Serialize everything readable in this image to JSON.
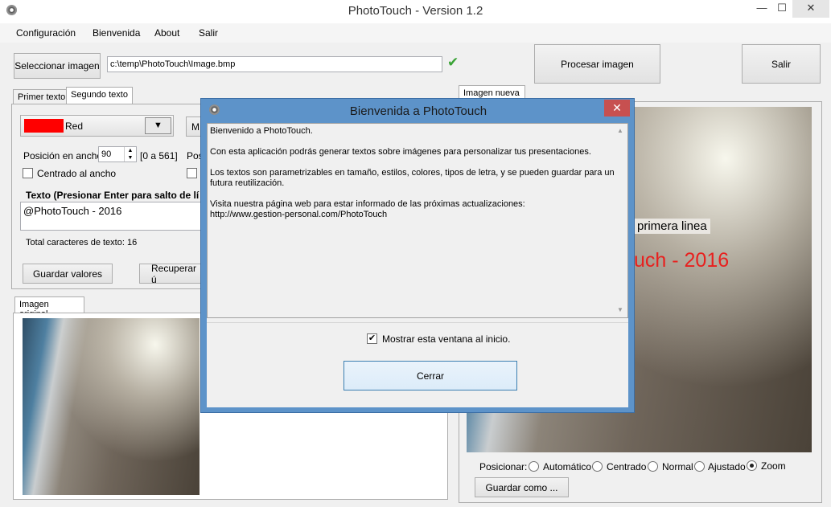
{
  "window": {
    "title": "PhotoTouch - Version 1.2",
    "controls": {
      "minimize": "—",
      "maximize": "☐",
      "close": "✕"
    }
  },
  "menu": [
    "Configuración",
    "Bienvenida",
    "About",
    "Salir"
  ],
  "toolbar": {
    "select_image_label": "Seleccionar imagen",
    "image_path": "c:\\temp\\PhotoTouch\\Image.bmp",
    "valid_icon": "✔",
    "process_label": "Procesar imagen",
    "exit_label": "Salir"
  },
  "tabs": [
    "Primer texto",
    "Segundo texto"
  ],
  "text_settings": {
    "color_name": "Red",
    "color_hex": "#ff0000",
    "dropdown_arrow": "▼",
    "second_button_partial": "M",
    "pos_x_label": "Posición en ancho:",
    "pos_x_value": "90",
    "pos_x_range": "[0 a 561]",
    "pos_y_label_partial": "Pos",
    "center_x_label": "Centrado al ancho",
    "text_label": "Texto (Presionar Enter para salto de lí",
    "text_value": "@PhotoTouch - 2016",
    "total_chars": "Total caracteres de texto: 16",
    "save_values_label": "Guardar valores",
    "recover_label_partial": "Recuperar ú"
  },
  "original_image_tab": "Imagen original",
  "new_image_tab": "Imagen nueva",
  "overlay": {
    "first_line": "primera linea",
    "second_line": "uch - 2016"
  },
  "position": {
    "label": "Posicionar:",
    "options": [
      "Automático",
      "Centrado",
      "Normal",
      "Ajustado",
      "Zoom"
    ],
    "selected": "Zoom"
  },
  "save_as_label": "Guardar como ...",
  "dialog": {
    "title": "Bienvenida a PhotoTouch",
    "close_glyph": "✕",
    "lines": [
      "Bienvenido a PhotoTouch.",
      "Con esta aplicación podrás generar textos sobre imágenes para personalizar tus presentaciones.",
      "Los textos son parametrizables en tamaño, estilos, colores, tipos de letra,  y se pueden guardar para una",
      "futura reutilización.",
      "Visita nuestra página web para estar informado de las próximas actualizaciones:",
      "http://www.gestion-personal.com/PhotoTouch"
    ],
    "show_on_start_label": "Mostrar esta ventana al inicio.",
    "show_on_start_checked": true,
    "close_button_label": "Cerrar"
  },
  "colors": {
    "accent_blue": "#5d93c9",
    "dialog_close_red": "#c75050",
    "overlay_text_red": "#e8201e",
    "valid_green": "#3aa336"
  }
}
